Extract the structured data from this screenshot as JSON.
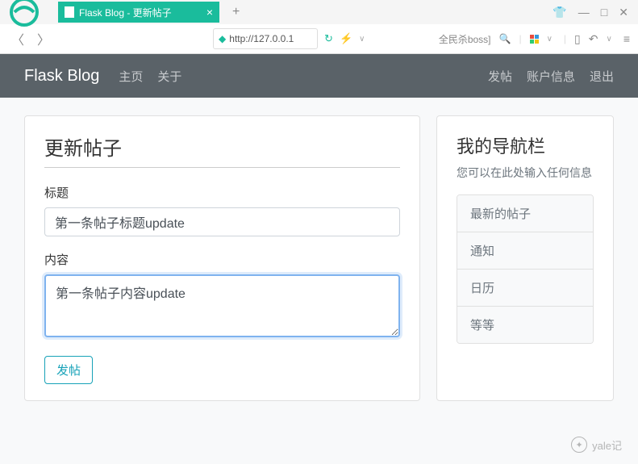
{
  "browser": {
    "tab_title": "Flask Blog - 更新帖子",
    "url": "http://127.0.0.1",
    "search_hint": "全民杀boss]",
    "window_controls": {
      "min": "—",
      "max": "□",
      "close": "✕"
    }
  },
  "navbar": {
    "brand": "Flask Blog",
    "links": [
      "主页",
      "关于"
    ],
    "right": [
      "发帖",
      "账户信息",
      "退出"
    ]
  },
  "form": {
    "heading": "更新帖子",
    "title_label": "标题",
    "title_value": "第一条帖子标题update",
    "content_label": "内容",
    "content_value": "第一条帖子内容update",
    "submit_label": "发帖"
  },
  "sidebar": {
    "heading": "我的导航栏",
    "desc": "您可以在此处输入任何信息",
    "items": [
      "最新的帖子",
      "通知",
      "日历",
      "等等"
    ]
  },
  "watermark": "yale记"
}
